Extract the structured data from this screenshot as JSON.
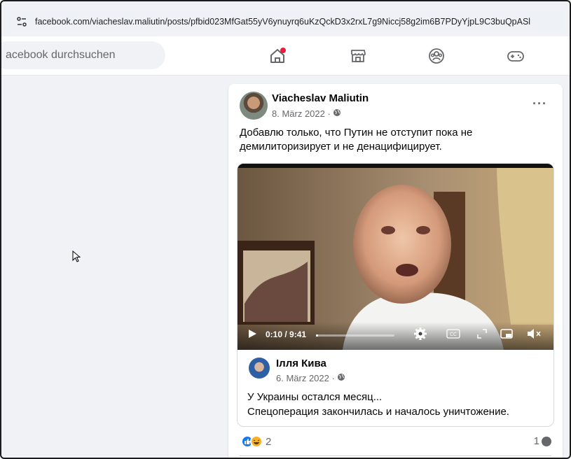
{
  "browser": {
    "url": "facebook.com/viacheslav.maliutin/posts/pfbid023MfGat55yV6ynuyrq6uKzQckD3x2rxL7g9Niccj58g2im6B7PDyYjpL9C3buQpASl",
    "url_icon": "tune-icon"
  },
  "topbar": {
    "search_placeholder": "acebook durchsuchen",
    "nav": [
      "home-icon",
      "marketplace-icon",
      "groups-icon",
      "gaming-icon"
    ],
    "notification_color": "#e41e3f"
  },
  "post": {
    "author": "Viacheslav Maliutin",
    "date": "8. März 2022 ·",
    "audience_icon": "globe-icon",
    "more": "···",
    "text": "Добавлю только, что Путин не отступит пока не демилиторизирует и не денацифицирует.",
    "video": {
      "time": "0:10 / 9:41",
      "progress": 0.02,
      "controls": [
        "play-icon",
        "settings-icon",
        "captions-icon",
        "fullscreen-icon",
        "miniplayer-icon",
        "mute-icon"
      ]
    },
    "shared": {
      "author": "Ілля Кива",
      "date": "6. März 2022 ·",
      "text_line1": "У Украины остался месяц...",
      "text_line2": "Спецоперация закончилась и началось уничтожение."
    },
    "reactions_count": "2",
    "comments_count": "1"
  },
  "colors": {
    "brand": "#1877f2",
    "secondary_text": "#65676b"
  }
}
